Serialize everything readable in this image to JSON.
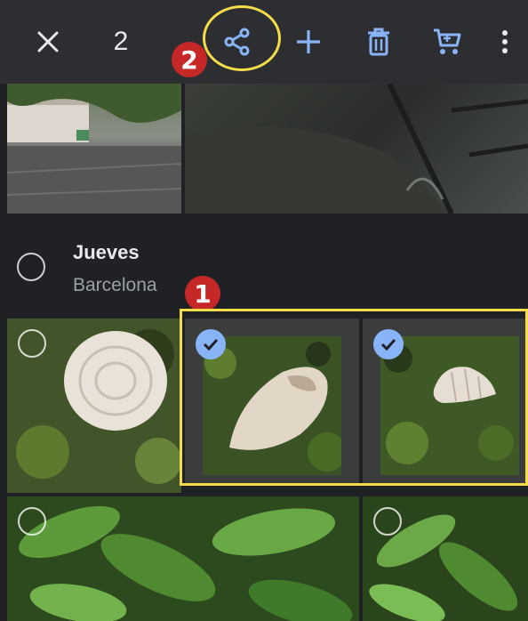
{
  "toolbar": {
    "selected_count": "2",
    "icons": [
      "close-icon",
      "share-icon",
      "add-icon",
      "trash-icon",
      "cart-icon",
      "more-vert-icon"
    ]
  },
  "annotations": {
    "step1": "1",
    "step2": "2"
  },
  "section": {
    "title": "Jueves",
    "subtitle": "Barcelona"
  },
  "colors": {
    "accent_yellow": "#f4dc4a",
    "share_blue": "#8ab4f8",
    "badge_red": "#c62828",
    "toolbar_bg": "#2d2e31",
    "background": "#202124"
  },
  "photos": {
    "top_left": "rainy-street",
    "top_right": "wet-stones",
    "row2_1": "round-snail-shell",
    "row2_2": "broken-snail-shell",
    "row2_3": "small-snail-shell",
    "row3_1": "green-leaves",
    "row3_2": "green-leaves"
  }
}
